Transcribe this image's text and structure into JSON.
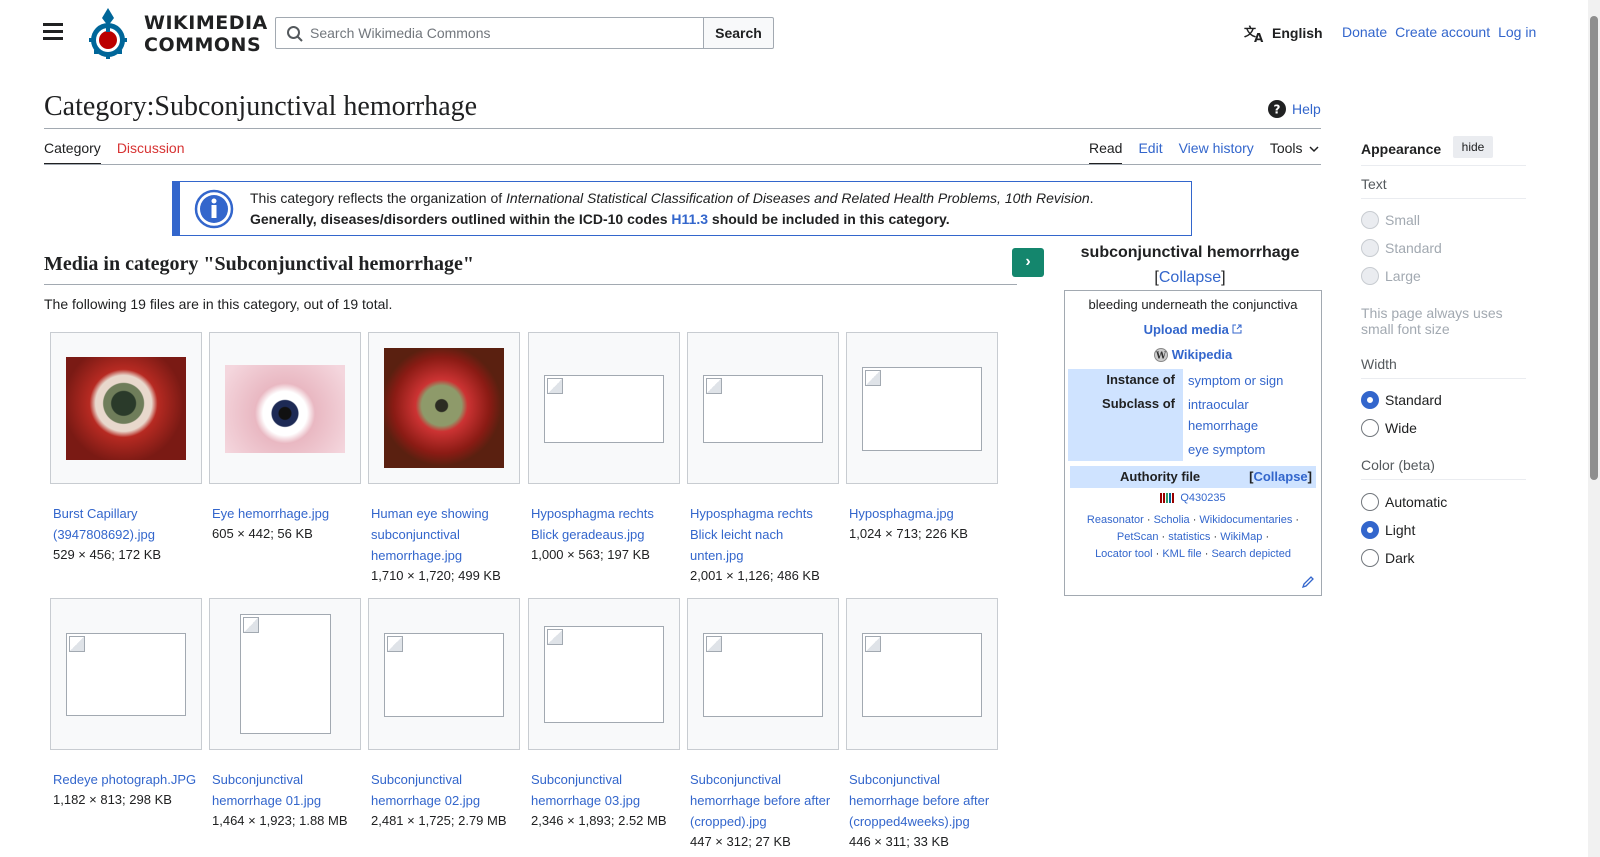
{
  "header": {
    "logo_line1": "WIKIMEDIA",
    "logo_line2": "COMMONS",
    "search_placeholder": "Search Wikimedia Commons",
    "search_button": "Search",
    "language": "English",
    "links": [
      "Donate",
      "Create account",
      "Log in"
    ]
  },
  "page": {
    "title": "Category:Subconjunctival hemorrhage",
    "help": "Help",
    "tabs_left": [
      "Category",
      "Discussion"
    ],
    "tabs_right": [
      "Read",
      "Edit",
      "View history",
      "Tools"
    ]
  },
  "notice": {
    "text1": "This category reflects the organization of ",
    "text1_italic": "International Statistical Classification of Diseases and Related Health Problems, 10th Revision",
    "text1_end": ".",
    "text2_start": "Generally, diseases/disorders outlined within the ICD-10 codes ",
    "code": "H11.3",
    "text2_end": " should be included in this category."
  },
  "media": {
    "heading": "Media in category \"Subconjunctival hemorrhage\"",
    "count_text": "The following 19 files are in this category, out of 19 total.",
    "items": [
      {
        "name": "Burst Capillary (3947808692).jpg",
        "meta": "529 × 456; 172 KB"
      },
      {
        "name": "Eye hemorrhage.jpg",
        "meta": "605 × 442; 56 KB"
      },
      {
        "name": "Human eye showing subconjunctival hemorrhage.jpg",
        "meta": "1,710 × 1,720; 499 KB"
      },
      {
        "name": "Hyposphagma rechts Blick geradeaus.jpg",
        "meta": "1,000 × 563; 197 KB"
      },
      {
        "name": "Hyposphagma rechts Blick leicht nach unten.jpg",
        "meta": "2,001 × 1,126; 486 KB"
      },
      {
        "name": "Hyposphagma.jpg",
        "meta": "1,024 × 713; 226 KB"
      },
      {
        "name": "Redeye photograph.JPG",
        "meta": "1,182 × 813; 298 KB"
      },
      {
        "name": "Subconjunctival hemorrhage 01.jpg",
        "meta": "1,464 × 1,923; 1.88 MB"
      },
      {
        "name": "Subconjunctival hemorrhage 02.jpg",
        "meta": "2,481 × 1,725; 2.79 MB"
      },
      {
        "name": "Subconjunctival hemorrhage 03.jpg",
        "meta": "2,346 × 1,893; 2.52 MB"
      },
      {
        "name": "Subconjunctival hemorrhage before after (cropped).jpg",
        "meta": "447 × 312; 27 KB"
      },
      {
        "name": "Subconjunctival hemorrhage before after (cropped4weeks).jpg",
        "meta": "446 × 311; 33 KB"
      }
    ]
  },
  "infobox": {
    "title": "subconjunctival hemorrhage",
    "collapse": "Collapse",
    "description": "bleeding underneath the conjunctiva",
    "upload": "Upload media",
    "wikipedia": "Wikipedia",
    "instance_label": "Instance of",
    "instance_value": "symptom or sign",
    "subclass_label": "Subclass of",
    "subclass_values": [
      "intraocular hemorrhage",
      "eye symptom"
    ],
    "authority_label": "Authority file",
    "authority_collapse": "Collapse",
    "qid": "Q430235",
    "tools": [
      "Reasonator",
      "Scholia",
      "Wikidocumentaries",
      "PetScan",
      "statistics",
      "WikiMap",
      "Locator tool",
      "KML file",
      "Search depicted"
    ]
  },
  "appearance": {
    "title": "Appearance",
    "hide": "hide",
    "text_label": "Text",
    "text_options": [
      "Small",
      "Standard",
      "Large"
    ],
    "note": "This page always uses small font size",
    "width_label": "Width",
    "width_options": [
      "Standard",
      "Wide"
    ],
    "color_label": "Color (beta)",
    "color_options": [
      "Automatic",
      "Light",
      "Dark"
    ]
  },
  "colors": {
    "link": "#3366cc",
    "redlink": "#d73333",
    "accent": "#36c",
    "green": "#14866d"
  }
}
